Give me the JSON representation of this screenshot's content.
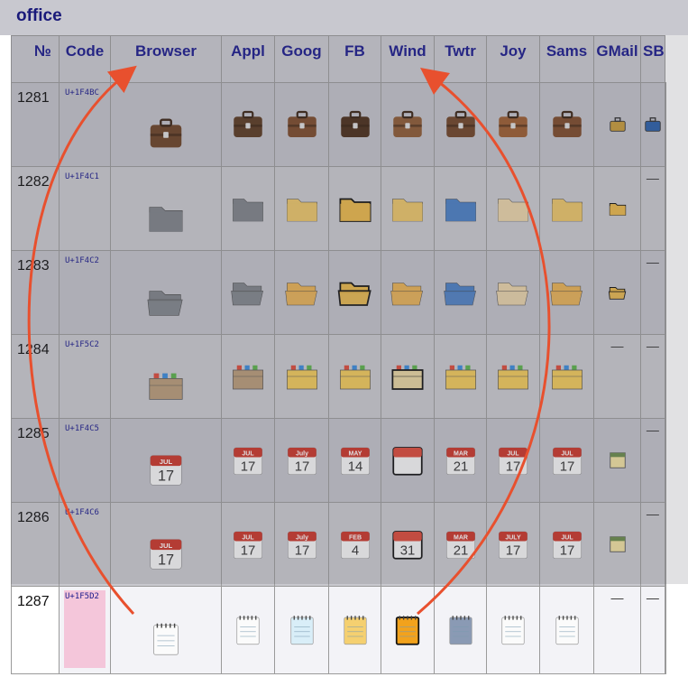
{
  "section": {
    "title": "office"
  },
  "headers": [
    "№",
    "Code",
    "Browser",
    "Appl",
    "Goog",
    "FB",
    "Wind",
    "Twtr",
    "Joy",
    "Sams",
    "GMail",
    "SB"
  ],
  "dash": "—",
  "rows": [
    {
      "num": "1281",
      "code": "U+1F4BC",
      "name": "briefcase",
      "cells": [
        "briefcase-icon",
        "briefcase-icon",
        "briefcase-icon",
        "briefcase-icon",
        "briefcase-icon",
        "briefcase-icon",
        "briefcase-icon",
        "briefcase-icon",
        "briefcase-small-icon",
        "briefcase-small-icon"
      ]
    },
    {
      "num": "1282",
      "code": "U+1F4C1",
      "name": "file folder",
      "cells": [
        "folder-icon",
        "folder-icon",
        "folder-icon",
        "folder-icon",
        "folder-icon",
        "folder-icon",
        "folder-icon",
        "folder-icon",
        "folder-small-icon",
        "none"
      ]
    },
    {
      "num": "1283",
      "code": "U+1F4C2",
      "name": "open file folder",
      "cells": [
        "open-folder-icon",
        "open-folder-icon",
        "open-folder-icon",
        "open-folder-icon",
        "open-folder-icon",
        "open-folder-icon",
        "open-folder-icon",
        "open-folder-icon",
        "open-folder-small-icon",
        "none"
      ]
    },
    {
      "num": "1284",
      "code": "U+1F5C2",
      "name": "card index dividers",
      "cells": [
        "card-index-icon",
        "card-index-icon",
        "card-index-icon",
        "card-index-icon",
        "card-index-icon",
        "card-index-icon",
        "card-index-icon",
        "card-index-icon",
        "none",
        "none"
      ]
    },
    {
      "num": "1285",
      "code": "U+1F4C5",
      "name": "calendar",
      "cells": [
        "calendar-icon",
        "calendar-icon",
        "calendar-icon",
        "calendar-icon",
        "calendar-icon",
        "calendar-icon",
        "calendar-icon",
        "calendar-icon",
        "calendar-small-icon",
        "none"
      ]
    },
    {
      "num": "1286",
      "code": "U+1F4C6",
      "name": "tear-off calendar",
      "cells": [
        "tearoff-calendar-icon",
        "tearoff-calendar-icon",
        "tearoff-calendar-icon",
        "tearoff-calendar-icon",
        "tearoff-calendar-icon",
        "tearoff-calendar-icon",
        "tearoff-calendar-icon",
        "tearoff-calendar-icon",
        "tearoff-calendar-small-icon",
        "none"
      ]
    },
    {
      "num": "1287",
      "code": "U+1F5D2",
      "name": "spiral notepad",
      "cells": [
        "notepad-icon",
        "notepad-icon",
        "notepad-icon",
        "notepad-icon",
        "notepad-icon",
        "notepad-icon",
        "notepad-icon",
        "notepad-icon",
        "none",
        "none"
      ]
    }
  ],
  "calendar_labels": {
    "browser": [
      "JUL",
      "17"
    ],
    "r1285": [
      [
        "JUL",
        "17"
      ],
      [
        "July",
        "17"
      ],
      [
        "MAY",
        "14"
      ],
      [
        "",
        ""
      ],
      [
        "MAR",
        "21"
      ],
      [
        "JUL",
        "17"
      ],
      [
        "JUL",
        "17"
      ]
    ],
    "r1286": [
      [
        "JUL",
        "17"
      ],
      [
        "July",
        "17"
      ],
      [
        "FEB",
        "4"
      ],
      [
        "",
        "31"
      ],
      [
        "MAR",
        "21"
      ],
      [
        "JULY",
        "17"
      ],
      [
        "JUL",
        "17"
      ]
    ]
  },
  "annotation": {
    "arrow_color": "#e8502e",
    "arrow_count": 2
  }
}
